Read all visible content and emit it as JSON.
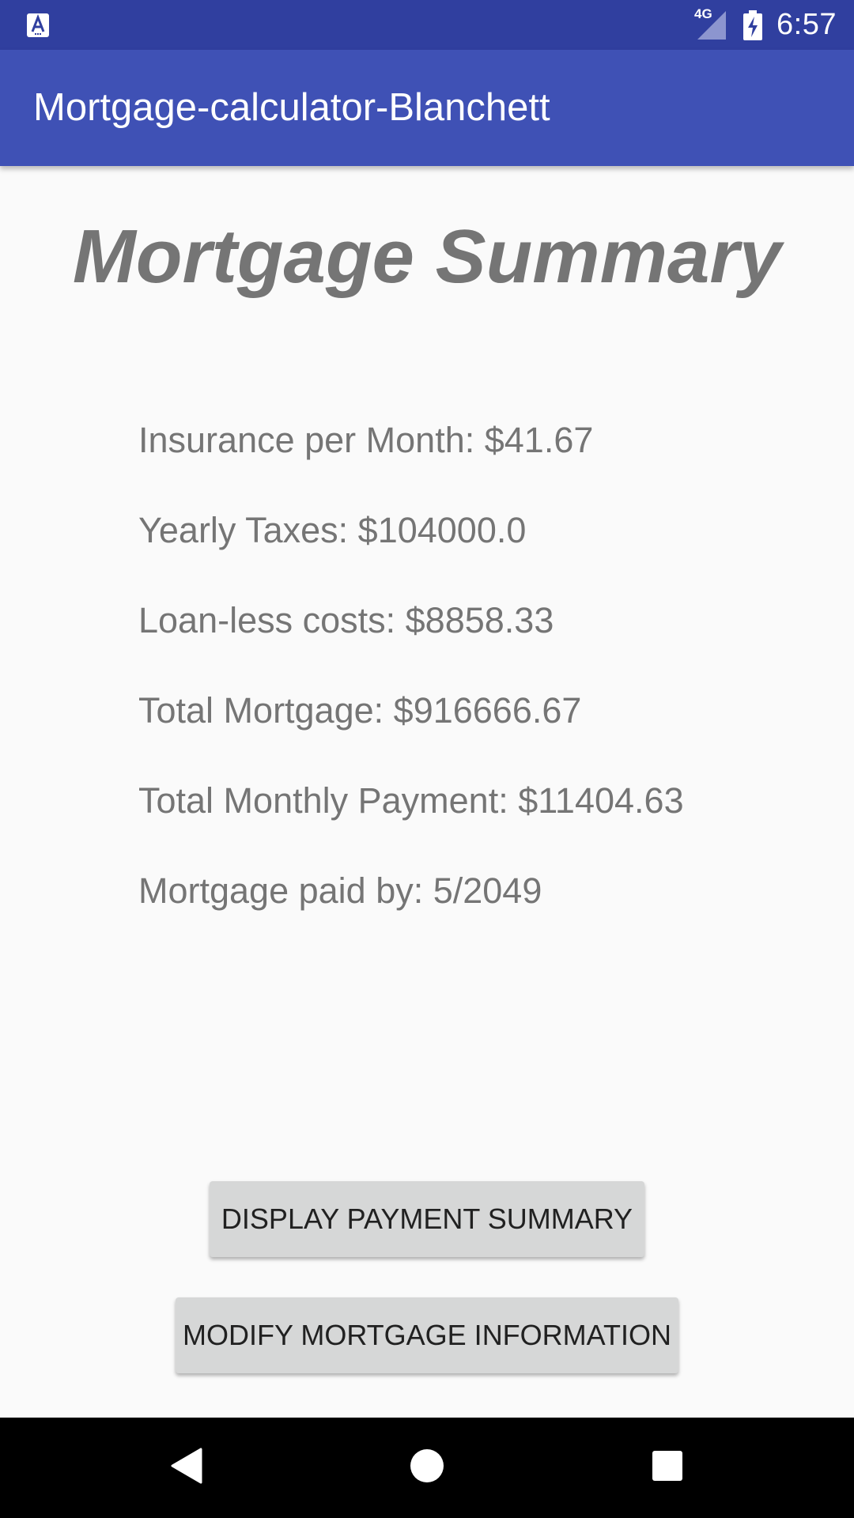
{
  "status_bar": {
    "time": "6:57",
    "network_label": "4G",
    "left_icon": "font-a-icon",
    "signal_icon": "cellular-signal-icon",
    "battery_icon": "battery-charging-icon"
  },
  "app_bar": {
    "title": "Mortgage-calculator-Blanchett"
  },
  "main": {
    "heading": "Mortgage Summary",
    "items": [
      "Insurance per Month: $41.67",
      "Yearly Taxes: $104000.0",
      "Loan-less costs: $8858.33",
      "Total Mortgage: $916666.67",
      "Total Monthly Payment: $11404.63",
      "Mortgage paid by: 5/2049"
    ],
    "buttons": {
      "display_label": "DISPLAY PAYMENT SUMMARY",
      "modify_label": "MODIFY MORTGAGE INFORMATION"
    }
  },
  "nav_bar": {
    "back_icon": "back-triangle-icon",
    "home_icon": "home-circle-icon",
    "recents_icon": "recents-square-icon"
  },
  "colors": {
    "status_bar": "#303f9f",
    "app_bar": "#3f51b5",
    "text_gray": "#757575",
    "button_bg": "#d6d7d7",
    "background": "#fafafa"
  }
}
